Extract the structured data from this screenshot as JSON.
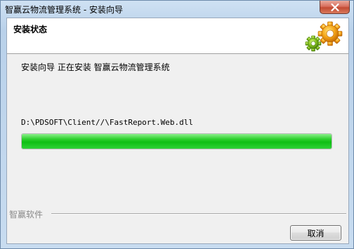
{
  "window": {
    "title": "智赢云物流管理系统 - 安装向导",
    "close_icon": "close-icon"
  },
  "header": {
    "title": "安装状态",
    "icon": "gears-icon",
    "gear_colors": [
      "#f3a21b",
      "#7fbf1e"
    ]
  },
  "main": {
    "status_text": "安装向导 正在安装 智赢云物流管理系统",
    "current_file": "D:\\PDSOFT\\Client//\\FastReport.Web.dll",
    "progress": 1.0,
    "progress_color": "#14c31a"
  },
  "footer": {
    "brand": "智赢软件",
    "cancel_label": "取消"
  }
}
